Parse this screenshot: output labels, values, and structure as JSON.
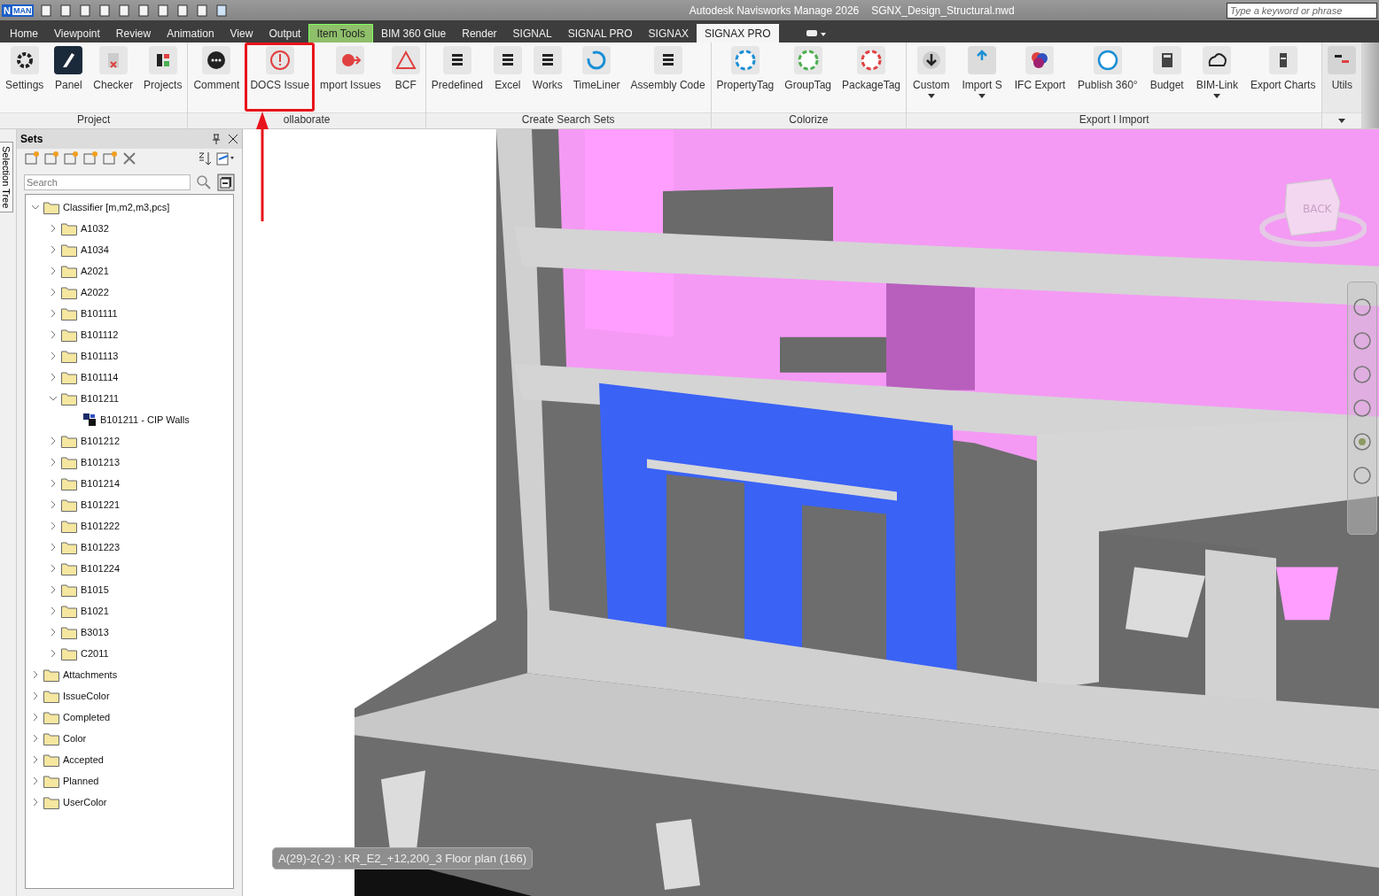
{
  "title_bar": {
    "title": "Autodesk Navisworks Manage 2026",
    "file": "SGNX_Design_Structural.nwd",
    "app_badge": "N",
    "app_badge_sub": "MAN",
    "search": {
      "placeholder": "Type a keyword or phrase"
    }
  },
  "tabs": [
    {
      "label": "Home",
      "selected": false,
      "contextual": false
    },
    {
      "label": "Viewpoint",
      "selected": false,
      "contextual": false
    },
    {
      "label": "Review",
      "selected": false,
      "contextual": false
    },
    {
      "label": "Animation",
      "selected": false,
      "contextual": false
    },
    {
      "label": "View",
      "selected": false,
      "contextual": false
    },
    {
      "label": "Output",
      "selected": false,
      "contextual": false
    },
    {
      "label": "Item Tools",
      "selected": false,
      "contextual": true
    },
    {
      "label": "BIM 360 Glue",
      "selected": false,
      "contextual": false
    },
    {
      "label": "Render",
      "selected": false,
      "contextual": false
    },
    {
      "label": "SIGNAL",
      "selected": false,
      "contextual": false
    },
    {
      "label": "SIGNAL PRO",
      "selected": false,
      "contextual": false
    },
    {
      "label": "SIGNAX",
      "selected": false,
      "contextual": false
    },
    {
      "label": "SIGNAX PRO",
      "selected": true,
      "contextual": false
    }
  ],
  "ribbon_groups": [
    {
      "label": "Project",
      "buttons": [
        {
          "label": "Settings"
        },
        {
          "label": "Panel"
        },
        {
          "label": "Checker"
        },
        {
          "label": "Projects"
        }
      ]
    },
    {
      "label": "ollaborate",
      "buttons": [
        {
          "label": "Comment"
        },
        {
          "label": "DOCS Issue",
          "highlighted": true
        },
        {
          "label": "mport Issues"
        },
        {
          "label": "BCF"
        }
      ]
    },
    {
      "label": "Create Search Sets",
      "buttons": [
        {
          "label": "Predefined"
        },
        {
          "label": "Excel"
        },
        {
          "label": "Works"
        },
        {
          "label": "TimeLiner"
        },
        {
          "label": "Assembly Code"
        }
      ]
    },
    {
      "label": "Colorize",
      "buttons": [
        {
          "label": "PropertyTag"
        },
        {
          "label": "GroupTag"
        },
        {
          "label": "PackageTag"
        }
      ]
    },
    {
      "label": "Export I Import",
      "buttons": [
        {
          "label": "Custom",
          "dropdown": true
        },
        {
          "label": "Import S",
          "dropdown": true
        },
        {
          "label": "IFC Export"
        },
        {
          "label": "Publish 360°"
        },
        {
          "label": "Budget"
        },
        {
          "label": "BIM-Link",
          "dropdown": true
        },
        {
          "label": "Export Charts"
        }
      ]
    },
    {
      "buttons": [
        {
          "label": "Utils"
        }
      ]
    }
  ],
  "side_tab": "Selection Tree",
  "sets_panel": {
    "title": "Sets",
    "search": {
      "placeholder": "Search"
    },
    "tree": [
      {
        "label": "Classifier [m,m2,m3,pcs]",
        "expanded": true,
        "children": [
          {
            "label": "A1032",
            "expanded": false
          },
          {
            "label": "A1034",
            "expanded": false
          },
          {
            "label": "A2021",
            "expanded": false
          },
          {
            "label": "A2022",
            "expanded": false
          },
          {
            "label": "B101111",
            "expanded": false
          },
          {
            "label": "B101112",
            "expanded": false
          },
          {
            "label": "B101113",
            "expanded": false
          },
          {
            "label": "B101114",
            "expanded": false
          },
          {
            "label": "B101211",
            "expanded": true,
            "children": [
              {
                "label": "B101211 - CIP Walls",
                "kind": "set"
              }
            ]
          },
          {
            "label": "B101212",
            "expanded": false
          },
          {
            "label": "B101213",
            "expanded": false
          },
          {
            "label": "B101214",
            "expanded": false
          },
          {
            "label": "B101221",
            "expanded": false
          },
          {
            "label": "B101222",
            "expanded": false
          },
          {
            "label": "B101223",
            "expanded": false
          },
          {
            "label": "B101224",
            "expanded": false
          },
          {
            "label": "B1015",
            "expanded": false
          },
          {
            "label": "B1021",
            "expanded": false
          },
          {
            "label": "B3013",
            "expanded": false
          },
          {
            "label": "C2011",
            "expanded": false
          }
        ]
      },
      {
        "label": "Attachments",
        "expanded": false
      },
      {
        "label": "IssueColor",
        "expanded": false
      },
      {
        "label": "Completed",
        "expanded": false
      },
      {
        "label": "Color",
        "expanded": false
      },
      {
        "label": "Accepted",
        "expanded": false
      },
      {
        "label": "Planned",
        "expanded": false
      },
      {
        "label": "UserColor",
        "expanded": false
      }
    ]
  },
  "viewport": {
    "view_cube": "BACK",
    "tooltip": "A(29)-2(-2) : KR_E2_+12,200_3 Floor plan (166)"
  }
}
